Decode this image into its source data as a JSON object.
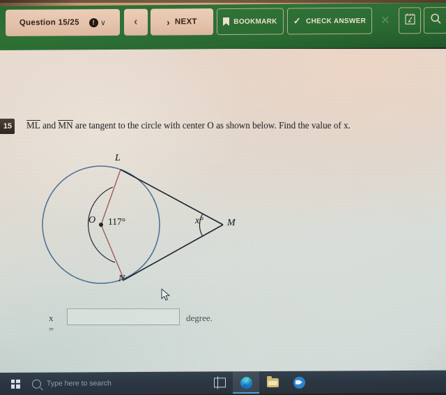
{
  "toolbar": {
    "question_label": "Question 15/25",
    "warning_icon": "exclamation-circle-icon",
    "chevron": "∨",
    "prev_label": "‹",
    "next_arrow": "›",
    "next_label": "NEXT",
    "bookmark_label": "BOOKMARK",
    "check_label": "CHECK ANSWER",
    "check_icon": "✓",
    "close_label": "✕",
    "notes_icon": "notepad-icon",
    "search_icon": "magnifier-icon",
    "bg_color": "#2f7236",
    "button_fill": "#e5c3ac"
  },
  "question": {
    "number": "15",
    "text_part1": "ML",
    "text_part2": " and ",
    "text_part3": "MN",
    "text_part4": " are tangent to the circle with center O as shown below. Find the value of x."
  },
  "figure": {
    "type": "geometry-diagram",
    "circle_label": "circle with center O",
    "labels": {
      "L": "L",
      "N": "N",
      "O": "O",
      "M": "M",
      "angle_center": "117°",
      "angle_vertex": "x°"
    },
    "colors": {
      "circle": "#4a6e96",
      "radius": "#9d5c59",
      "tangent": "#1f2530"
    },
    "cursor": "mouse-pointer"
  },
  "answer": {
    "prefix": "x =",
    "value": "",
    "placeholder": "",
    "unit": "degree."
  },
  "taskbar": {
    "start_icon": "windows-logo-icon",
    "search_placeholder": "Type here to search",
    "search_icon": "magnifier-icon",
    "items": [
      {
        "name": "task-view-icon"
      },
      {
        "name": "microsoft-edge-icon"
      },
      {
        "name": "file-explorer-icon"
      },
      {
        "name": "video-call-icon"
      }
    ]
  }
}
